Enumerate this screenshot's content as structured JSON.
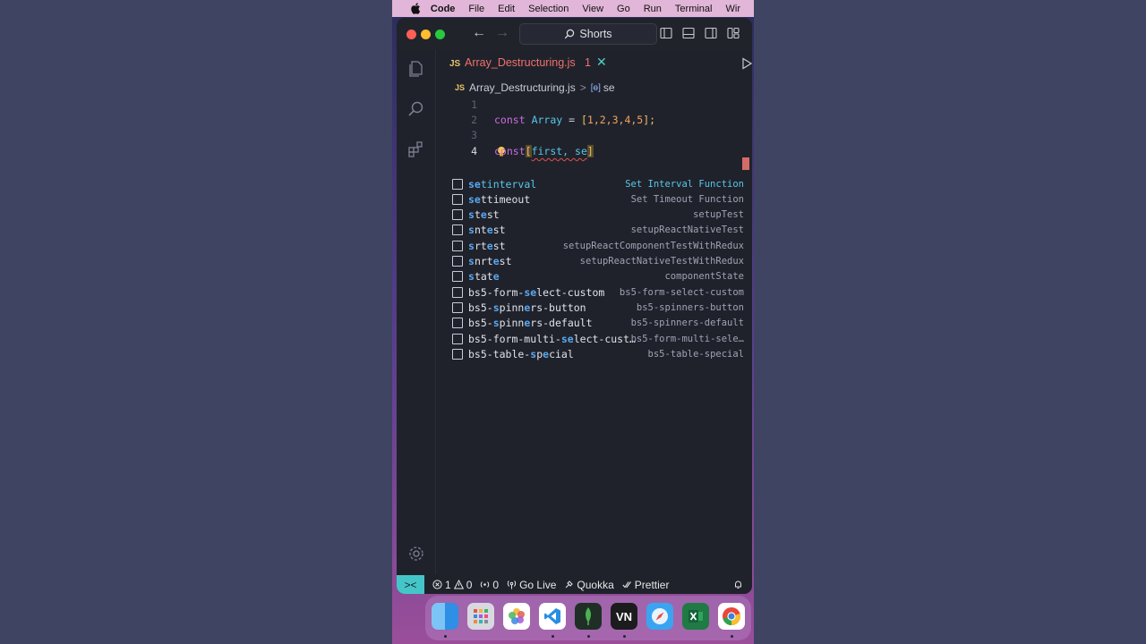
{
  "menubar": {
    "apple_icon": "apple-icon",
    "items": [
      "Code",
      "File",
      "Edit",
      "Selection",
      "View",
      "Go",
      "Run",
      "Terminal",
      "Wir"
    ]
  },
  "titlebar": {
    "search_text": "Shorts"
  },
  "tab": {
    "lang_badge": "JS",
    "filename": "Array_Destructuring.js",
    "problem_count": "1",
    "close_glyph": "✕"
  },
  "breadcrumb": {
    "lang_badge": "JS",
    "file": "Array_Destructuring.js",
    "separator": ">",
    "symbol_glyph": "[ɵ]",
    "symbol": "se"
  },
  "editor": {
    "line_numbers": [
      "1",
      "2",
      "3",
      "4"
    ],
    "line2": {
      "kw": "const",
      "name": "Array",
      "eq": " = ",
      "open": "[",
      "nums": "1,2,3,4,5",
      "close": "];"
    },
    "line4": {
      "kw": "const",
      "open": "[",
      "text": "first, se",
      "close": "]"
    }
  },
  "suggestions": [
    {
      "pre": "",
      "m": "se",
      "rest": "tinterval",
      "detail": "Set Interval Function"
    },
    {
      "pre": "",
      "m": "se",
      "rest": "ttimeout",
      "detail": "Set Timeout Function"
    },
    {
      "pre": "",
      "m": "s",
      "rest": "t",
      "m2": "e",
      "rest2": "st",
      "detail": "setupTest"
    },
    {
      "pre": "",
      "m": "s",
      "rest": "nt",
      "m2": "e",
      "rest2": "st",
      "detail": "setupReactNativeTest"
    },
    {
      "pre": "",
      "m": "s",
      "rest": "rt",
      "m2": "e",
      "rest2": "st",
      "detail": "setupReactComponentTestWithRedux"
    },
    {
      "pre": "",
      "m": "s",
      "rest": "nrt",
      "m2": "e",
      "rest2": "st",
      "detail": "setupReactNativeTestWithRedux"
    },
    {
      "pre": "",
      "m": "s",
      "rest": "tat",
      "m2": "e",
      "rest2": "",
      "detail": "componentState"
    },
    {
      "pre": "bs5-form-",
      "m": "se",
      "rest": "lect-custom",
      "detail": "bs5-form-select-custom"
    },
    {
      "pre": "bs5-",
      "m": "s",
      "rest": "pinn",
      "m2": "e",
      "rest2": "rs-button",
      "detail": "bs5-spinners-button"
    },
    {
      "pre": "bs5-",
      "m": "s",
      "rest": "pinn",
      "m2": "e",
      "rest2": "rs-default",
      "detail": "bs5-spinners-default"
    },
    {
      "pre": "bs5-form-multi-",
      "m": "se",
      "rest": "lect-cust…",
      "detail": "bs5-form-multi-sele…"
    },
    {
      "pre": "bs5-table-",
      "m": "s",
      "rest": "p",
      "m2": "e",
      "rest2": "cial",
      "detail": "bs5-table-special"
    }
  ],
  "statusbar": {
    "remote_glyph": "><",
    "errors": "1",
    "warnings": "0",
    "ports": "0",
    "golive": "Go Live",
    "quokka": "Quokka",
    "prettier": "Prettier"
  },
  "dock": {
    "apps": [
      "finder-icon",
      "launchpad-icon",
      "photos-icon",
      "vscode-icon",
      "mongodb-icon",
      "vn-icon",
      "safari-icon",
      "excel-icon",
      "chrome-icon"
    ],
    "vn_label": "VN"
  },
  "colors": {
    "accent": "#44c6c9",
    "error": "#f0716c",
    "keyword": "#c86ee0",
    "match": "#5aa8f0"
  }
}
